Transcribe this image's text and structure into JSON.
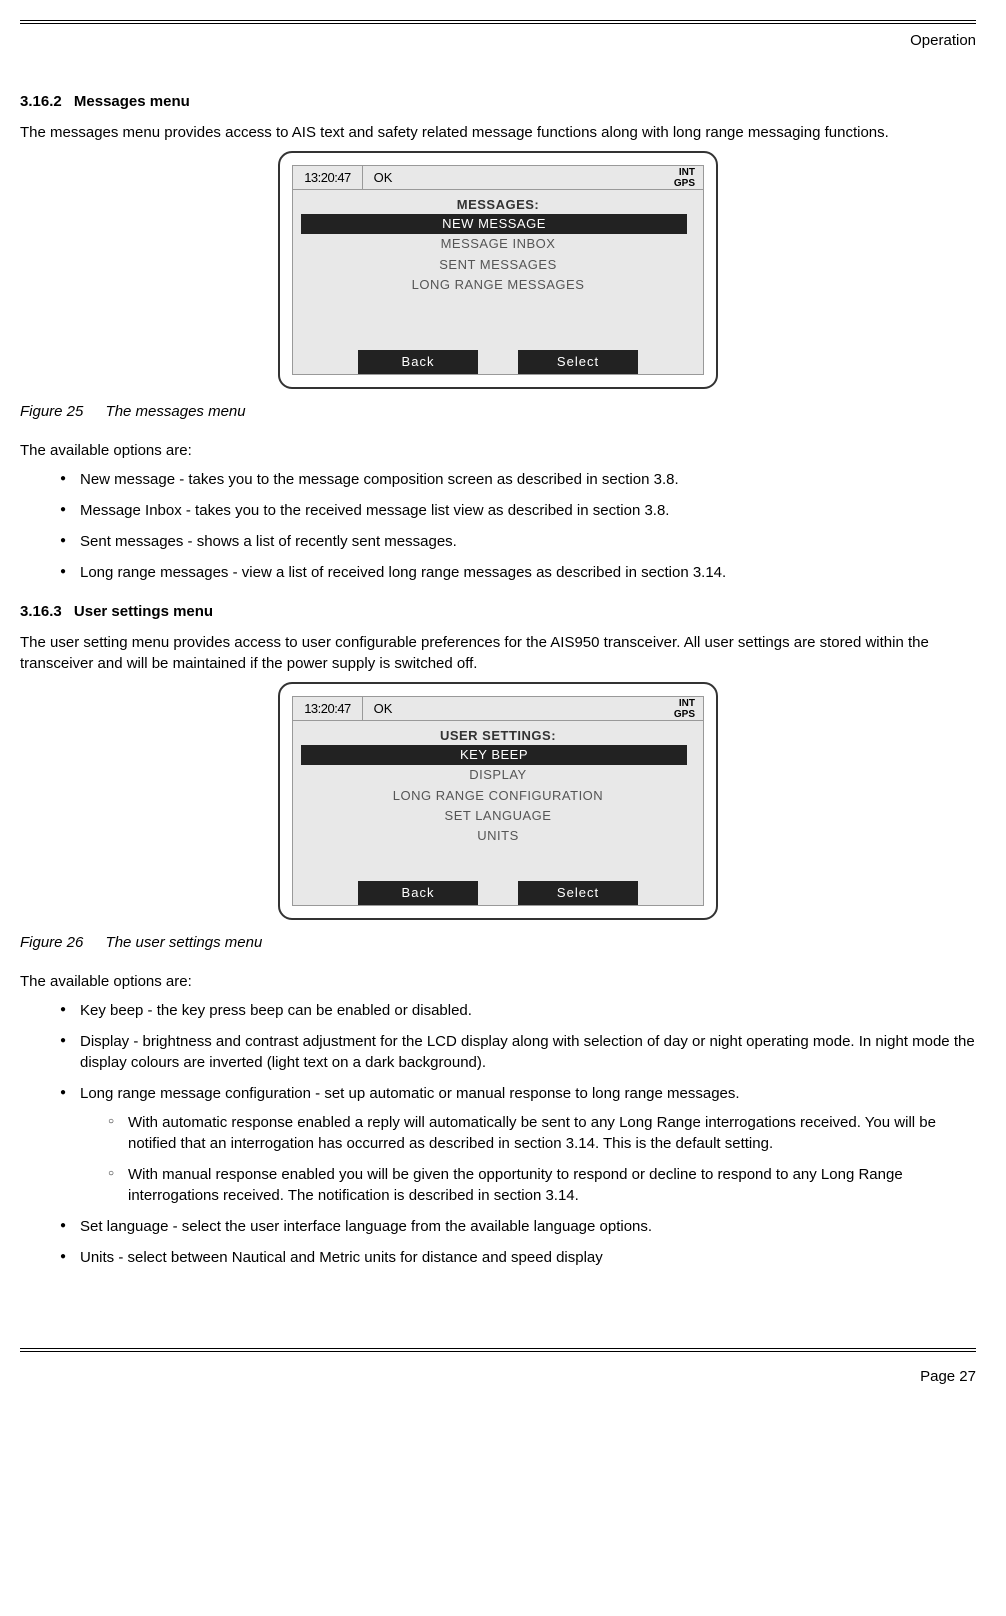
{
  "header": {
    "section": "Operation"
  },
  "s1": {
    "num": "3.16.2",
    "title": "Messages menu",
    "intro": "The messages menu provides access to AIS text and safety related message functions along with long range messaging functions."
  },
  "fig25": {
    "time": "13:20:47",
    "ok": "OK",
    "int1": "INT",
    "int2": "GPS",
    "title": "MESSAGES:",
    "items": {
      "0": "NEW MESSAGE",
      "1": "MESSAGE INBOX",
      "2": "SENT MESSAGES",
      "3": "LONG RANGE MESSAGES"
    },
    "back": "Back",
    "select": "Select",
    "caption_label": "Figure 25",
    "caption_text": "The messages menu"
  },
  "opts_intro": "The available options are:",
  "opts1": {
    "a": "New message - takes you to the message composition screen as described in section 3.8.",
    "b": "Message Inbox - takes you to the received message list view as described in section 3.8.",
    "c": "Sent messages - shows a list of recently sent messages.",
    "d": "Long range messages - view a list of received long range messages as described in section 3.14."
  },
  "s2": {
    "num": "3.16.3",
    "title": "User settings menu",
    "intro": "The user setting menu provides access to user configurable preferences for the AIS950 transceiver. All user settings are stored within the transceiver and will be maintained if the power supply is switched off."
  },
  "fig26": {
    "time": "13:20:47",
    "ok": "OK",
    "int1": "INT",
    "int2": "GPS",
    "title": "USER SETTINGS:",
    "items": {
      "0": "KEY BEEP",
      "1": "DISPLAY",
      "2": "LONG RANGE CONFIGURATION",
      "3": "SET LANGUAGE",
      "4": "UNITS"
    },
    "back": "Back",
    "select": "Select",
    "caption_label": "Figure 26",
    "caption_text": "The user settings menu"
  },
  "opts2": {
    "a": "Key beep - the key press beep can be enabled or disabled.",
    "b": "Display - brightness and contrast adjustment for the LCD display along with selection of day or night operating mode. In night mode the display colours are inverted (light text on a dark background).",
    "c": "Long range message configuration - set up automatic or manual response to long range messages.",
    "c1": "With automatic response enabled a reply will automatically be sent to any Long Range interrogations received. You will be notified that an interrogation has occurred as described in section 3.14. This is the default setting.",
    "c2": "With manual response enabled you will be given the opportunity to respond or decline to respond to any Long Range interrogations received. The notification is described in section 3.14.",
    "d": "Set language - select the user interface language from the available language options.",
    "e": "Units - select between Nautical and Metric units for distance and speed display"
  },
  "footer": {
    "page": "Page 27"
  }
}
